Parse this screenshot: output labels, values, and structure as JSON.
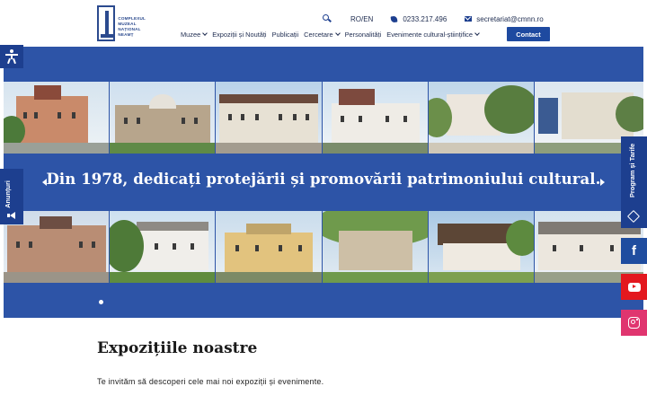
{
  "header": {
    "logo_lines": [
      "COMPLEXUL",
      "MUZEAL",
      "NAȚIONAL",
      "NEAMȚ"
    ],
    "language": "RO/EN",
    "phone": "0233.217.496",
    "email": "secretariat@cmnn.ro",
    "contact_label": "Contact"
  },
  "nav": [
    {
      "label": "Muzee",
      "dropdown": true
    },
    {
      "label": "Expoziții și Noutăți",
      "dropdown": false
    },
    {
      "label": "Publicații",
      "dropdown": false
    },
    {
      "label": "Cercetare",
      "dropdown": true
    },
    {
      "label": "Personalități",
      "dropdown": false
    },
    {
      "label": "Evenimente cultural-științifice",
      "dropdown": true
    }
  ],
  "side_tabs": {
    "announcements": "Anunțuri",
    "program": "Program și Tarife"
  },
  "social": [
    "facebook-icon",
    "youtube-icon",
    "instagram-icon"
  ],
  "hero": {
    "tagline": "Din 1978, dedicați protejării și promovării patrimoniului cultural.",
    "slide_count": 1,
    "active_slide": 1
  },
  "section": {
    "title": "Expozițiile noastre",
    "subtitle": "Te invităm să descoperi cele mai noi expoziții și evenimente."
  },
  "colors": {
    "primary": "#1d3f8f",
    "hero_bg": "#2d54a7",
    "contact_button": "#1e4aa0",
    "youtube": "#e3181e",
    "instagram": "#e0356f"
  }
}
